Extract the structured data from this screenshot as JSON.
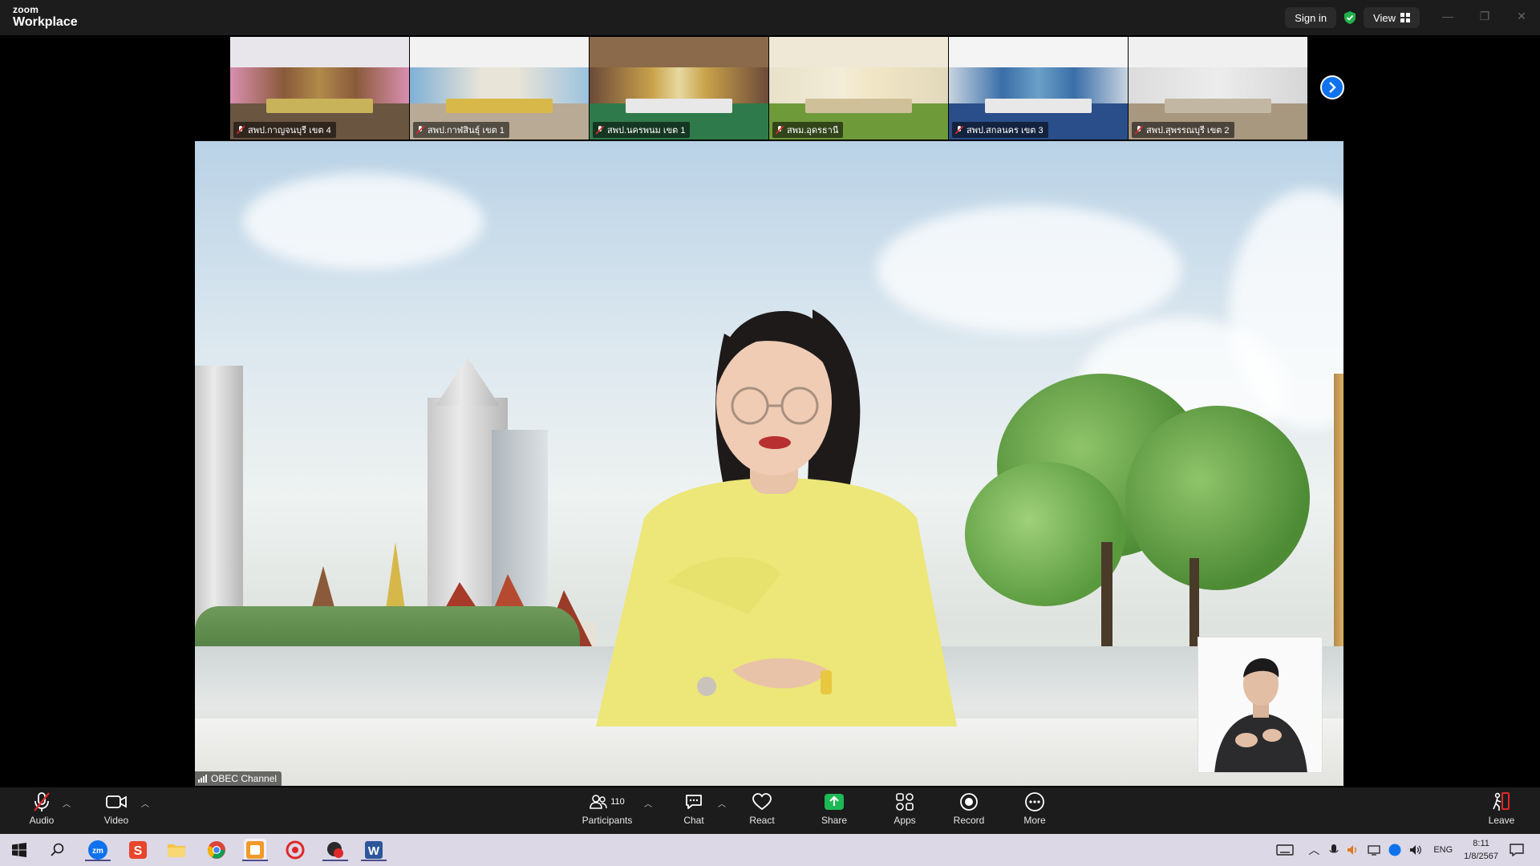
{
  "app": {
    "brand_small": "zoom",
    "brand_big": "Workplace"
  },
  "titlebar": {
    "sign_in": "Sign in",
    "view": "View"
  },
  "gallery": [
    {
      "name": "สพป.กาญจนบุรี เขต 4"
    },
    {
      "name": "สพป.กาฬสินธุ์ เขต 1"
    },
    {
      "name": "สพป.นครพนม เขต 1"
    },
    {
      "name": "สพม.อุดรธานี"
    },
    {
      "name": "สพป.สกลนคร เขต 3"
    },
    {
      "name": "สพป.สุพรรณบุรี เขต 2"
    }
  ],
  "main": {
    "channel_label": "OBEC Channel"
  },
  "toolbar": {
    "audio": "Audio",
    "video": "Video",
    "participants": "Participants",
    "participants_count": "110",
    "chat": "Chat",
    "react": "React",
    "share": "Share",
    "apps": "Apps",
    "record": "Record",
    "more": "More",
    "leave": "Leave"
  },
  "taskbar": {
    "language": "ENG",
    "time": "8:11",
    "date": "1/8/2567"
  },
  "colors": {
    "accent": "#0e72ed",
    "share_green": "#1db954",
    "leave_red": "#e02828"
  }
}
